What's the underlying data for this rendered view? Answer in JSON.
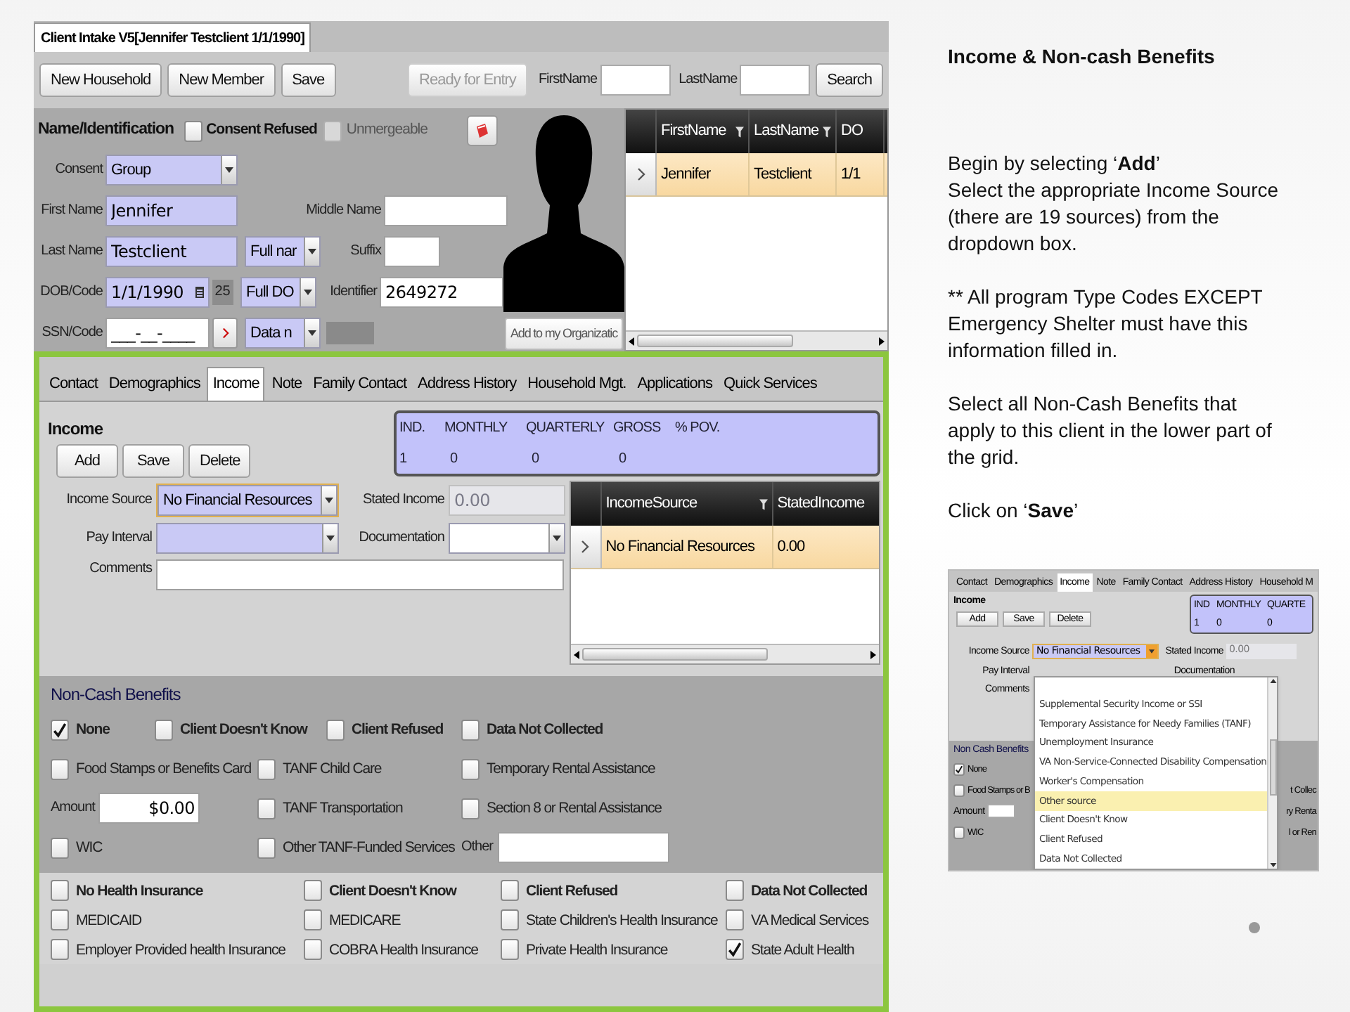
{
  "window": {
    "title": "Client Intake V5[Jennifer Testclient 1/1/1990]"
  },
  "toolbar": {
    "buttons": [
      "New Household",
      "New Member",
      "Save"
    ],
    "status": {
      "label": "Ready for Entry",
      "disabled": true
    },
    "search_fields": [
      "FirstName",
      "LastName"
    ],
    "search_button": "Search"
  },
  "identification": {
    "title": "Name/Identification",
    "checks": [
      {
        "label": "Consent Refused",
        "checked": false,
        "disabled": false
      },
      {
        "label": "Unmergeable",
        "checked": false,
        "disabled": true
      }
    ],
    "consent": {
      "label": "Consent",
      "value": "Group"
    },
    "first_name": {
      "label": "First Name",
      "value": "Jennifer"
    },
    "middle_name": {
      "label": "Middle Name"
    },
    "last_name": {
      "label": "Last Name",
      "value": "Testclient",
      "format": "Full nar"
    },
    "suffix": {
      "label": "Suffix"
    },
    "dob": {
      "label": "DOB/Code",
      "value": "1/1/1990",
      "age": "25",
      "format": "Full DO"
    },
    "identifier": {
      "label": "Identifier",
      "value": "2649272"
    },
    "ssn": {
      "label": "SSN/Code",
      "value": "___-__-____",
      "format": "Data n"
    },
    "org_button": "Add to my Organizatic"
  },
  "search_results": {
    "columns": [
      "FirstName",
      "LastName",
      "DO"
    ],
    "rows": [
      {
        "cells": [
          "Jennifer",
          "Testclient",
          "1/1"
        ],
        "selected": true
      }
    ]
  },
  "tabs": [
    {
      "label": "Contact",
      "selected": false
    },
    {
      "label": "Demographics",
      "selected": false
    },
    {
      "label": "Income",
      "selected": true
    },
    {
      "label": "Note",
      "selected": false
    },
    {
      "label": "Family Contact",
      "selected": false
    },
    {
      "label": "Address History",
      "selected": false
    },
    {
      "label": "Household Mgt.",
      "selected": false
    },
    {
      "label": "Applications",
      "selected": false
    },
    {
      "label": "Quick Services",
      "selected": false
    }
  ],
  "income": {
    "title": "Income",
    "buttons": [
      "Add",
      "Save",
      "Delete"
    ],
    "summary": {
      "headers": [
        "IND.",
        "MONTHLY",
        "QUARTERLY",
        "GROSS",
        "% POV."
      ],
      "values": [
        "1",
        "0",
        "0",
        "0"
      ]
    },
    "income_source": {
      "label": "Income Source",
      "value": "No Financial Resources"
    },
    "stated_income": {
      "label": "Stated Income",
      "value": "0.00",
      "disabled": true
    },
    "pay_interval": {
      "label": "Pay Interval"
    },
    "documentation": {
      "label": "Documentation"
    },
    "comments": {
      "label": "Comments"
    },
    "grid": {
      "columns": [
        "IncomeSource",
        "StatedIncome"
      ],
      "rows": [
        {
          "cells": [
            "No Financial Resources",
            "0.00"
          ],
          "selected": true
        }
      ]
    }
  },
  "non_cash": {
    "title": "Non-Cash Benefits",
    "status": [
      {
        "label": "None",
        "checked": true
      },
      {
        "label": "Client Doesn't Know",
        "checked": false
      },
      {
        "label": "Client Refused",
        "checked": false
      },
      {
        "label": "Data Not Collected",
        "checked": false
      }
    ],
    "rows": [
      [
        {
          "kind": "check",
          "label": "Food Stamps or Benefits Card",
          "checked": false
        },
        {
          "kind": "check",
          "label": "TANF Child Care",
          "checked": false
        },
        {
          "kind": "check",
          "label": "Temporary Rental Assistance",
          "checked": false
        }
      ],
      [
        {
          "kind": "field",
          "label": "Amount",
          "value": "$0.00"
        },
        {
          "kind": "check",
          "label": "TANF Transportation",
          "checked": false
        },
        {
          "kind": "check",
          "label": "Section 8 or Rental Assistance",
          "checked": false
        }
      ],
      [
        {
          "kind": "check",
          "label": "WIC",
          "checked": false
        },
        {
          "kind": "check",
          "label": "Other TANF-Funded Services",
          "checked": false
        },
        {
          "kind": "field",
          "label": "Other"
        }
      ]
    ]
  },
  "health": {
    "rows": [
      [
        {
          "kind": "status",
          "label": "No Health Insurance",
          "checked": false
        },
        {
          "kind": "status",
          "label": "Client Doesn't Know",
          "checked": false
        },
        {
          "kind": "status",
          "label": "Client Refused",
          "checked": false
        },
        {
          "kind": "status",
          "label": "Data Not Collected",
          "checked": false
        }
      ],
      [
        {
          "kind": "check",
          "label": "MEDICAID",
          "checked": false
        },
        {
          "kind": "check",
          "label": "MEDICARE",
          "checked": false
        },
        {
          "kind": "check",
          "label": "State Children's Health Insurance",
          "checked": false
        },
        {
          "kind": "check",
          "label": "VA Medical Services",
          "checked": false
        }
      ],
      [
        {
          "kind": "check",
          "label": "Employer Provided health Insurance",
          "checked": false
        },
        {
          "kind": "check",
          "label": "COBRA Health Insurance",
          "checked": false
        },
        {
          "kind": "check",
          "label": "Private Health Insurance",
          "checked": false
        },
        {
          "kind": "check",
          "label": "State Adult Health",
          "checked": true
        }
      ]
    ]
  },
  "instructions": {
    "title": "Income & Non-cash Benefits",
    "blocks": [
      [
        "Begin by selecting ‘**Add**’",
        "Select the appropriate Income Source (there are 19 sources) from the dropdown box."
      ],
      [
        "** All program Type Codes EXCEPT  Emergency Shelter must have this information filled in."
      ],
      [
        "Select all Non-Cash Benefits that apply to this client in the lower part of the grid."
      ],
      [
        "Click on ‘**Save**’"
      ]
    ]
  },
  "example": {
    "tabs": [
      {
        "label": "Contact",
        "selected": false
      },
      {
        "label": "Demographics",
        "selected": false
      },
      {
        "label": "Income",
        "selected": true
      },
      {
        "label": "Note",
        "selected": false
      },
      {
        "label": "Family Contact",
        "selected": false
      },
      {
        "label": "Address History",
        "selected": false
      },
      {
        "label": "Household M",
        "selected": false
      }
    ],
    "title": "Income",
    "buttons": [
      "Add",
      "Save",
      "Delete"
    ],
    "summary": {
      "headers": [
        "IND",
        "MONTHLY",
        "QUARTE"
      ],
      "values": [
        "1",
        "0",
        "0"
      ]
    },
    "income_source": {
      "label": "Income Source",
      "value": "No Financial Resources"
    },
    "stated_income": {
      "label": "Stated Income",
      "value": "0.00"
    },
    "pay_interval": {
      "label": "Pay Interval"
    },
    "documentation": {
      "label": "Documentation"
    },
    "comments": {
      "label": "Comments"
    },
    "dropdown": [
      {
        "label": "Supplemental Security Income or SSI",
        "selected": false
      },
      {
        "label": "Temporary Assistance for Needy Families (TANF)",
        "selected": false
      },
      {
        "label": "Unemployment Insurance",
        "selected": false
      },
      {
        "label": "VA Non-Service-Connected Disability Compensation",
        "selected": false
      },
      {
        "label": "Worker's Compensation",
        "selected": false
      },
      {
        "label": "Other source",
        "selected": true
      },
      {
        "label": "Client Doesn't Know",
        "selected": false
      },
      {
        "label": "Client Refused",
        "selected": false
      },
      {
        "label": "Data Not Collected",
        "selected": false
      }
    ],
    "non_cash": {
      "title": "Non Cash Benefits",
      "items": [
        {
          "kind": "check",
          "label": "None",
          "checked": true
        },
        {
          "kind": "check",
          "label": "Food Stamps or B",
          "checked": false
        },
        {
          "kind": "field",
          "label": "Amount"
        },
        {
          "kind": "check",
          "label": "WIC",
          "checked": false
        }
      ],
      "right_labels": [
        "t Collec",
        "ry Renta",
        "l or Ren"
      ]
    }
  }
}
